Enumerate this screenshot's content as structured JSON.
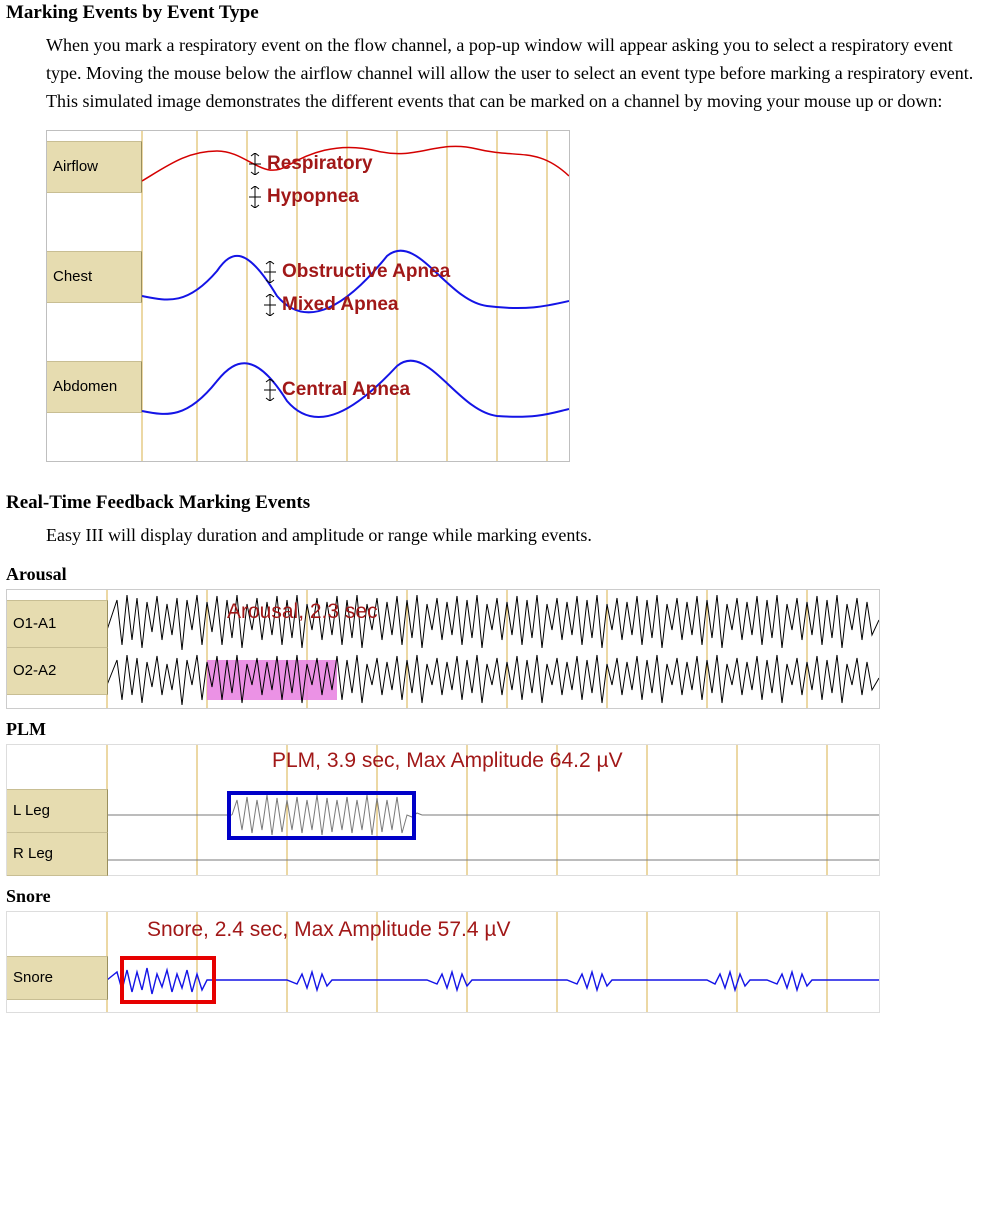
{
  "section1": {
    "title": "Marking Events by Event Type",
    "body": "When you mark a respiratory event on the flow channel, a pop-up window will appear asking you to select a respiratory event type. Moving the mouse below the airflow channel will allow the user to select an event type before marking a respiratory event. This simulated image demonstrates the different events that can be marked on a channel by moving your mouse up or down:"
  },
  "sim": {
    "channels": [
      "Airflow",
      "Chest",
      "Abdomen"
    ],
    "events": [
      "Respiratory",
      "Hypopnea",
      "Obstructive Apnea",
      "Mixed Apnea",
      "Central Apnea"
    ]
  },
  "section2": {
    "title": "Real-Time Feedback Marking Events",
    "body": "Easy III will display duration and amplitude or range while marking events."
  },
  "arousal": {
    "heading": "Arousal",
    "channels": [
      "O1-A1",
      "O2-A2"
    ],
    "label": "Arousal, 2.3 sec"
  },
  "plm": {
    "heading": "PLM",
    "channels": [
      "L Leg",
      "R Leg"
    ],
    "label": "PLM, 3.9 sec, Max Amplitude 64.2 µV"
  },
  "snore": {
    "heading": "Snore",
    "channels": [
      "Snore"
    ],
    "label": "Snore, 2.4 sec, Max Amplitude 57.4 µV"
  }
}
